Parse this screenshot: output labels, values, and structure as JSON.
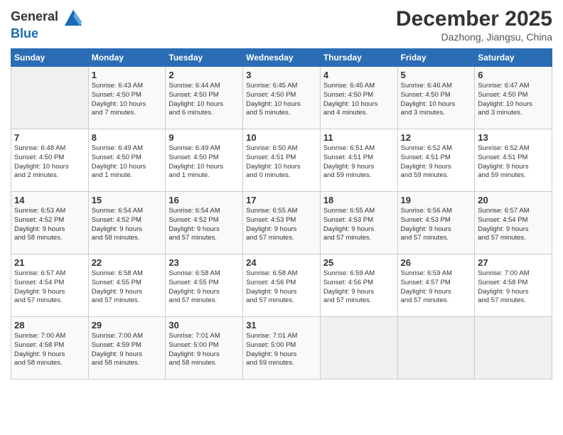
{
  "header": {
    "logo_line1": "General",
    "logo_line2": "Blue",
    "month": "December 2025",
    "location": "Dazhong, Jiangsu, China"
  },
  "weekdays": [
    "Sunday",
    "Monday",
    "Tuesday",
    "Wednesday",
    "Thursday",
    "Friday",
    "Saturday"
  ],
  "weeks": [
    [
      {
        "num": "",
        "info": ""
      },
      {
        "num": "1",
        "info": "Sunrise: 6:43 AM\nSunset: 4:50 PM\nDaylight: 10 hours\nand 7 minutes."
      },
      {
        "num": "2",
        "info": "Sunrise: 6:44 AM\nSunset: 4:50 PM\nDaylight: 10 hours\nand 6 minutes."
      },
      {
        "num": "3",
        "info": "Sunrise: 6:45 AM\nSunset: 4:50 PM\nDaylight: 10 hours\nand 5 minutes."
      },
      {
        "num": "4",
        "info": "Sunrise: 6:45 AM\nSunset: 4:50 PM\nDaylight: 10 hours\nand 4 minutes."
      },
      {
        "num": "5",
        "info": "Sunrise: 6:46 AM\nSunset: 4:50 PM\nDaylight: 10 hours\nand 3 minutes."
      },
      {
        "num": "6",
        "info": "Sunrise: 6:47 AM\nSunset: 4:50 PM\nDaylight: 10 hours\nand 3 minutes."
      }
    ],
    [
      {
        "num": "7",
        "info": "Sunrise: 6:48 AM\nSunset: 4:50 PM\nDaylight: 10 hours\nand 2 minutes."
      },
      {
        "num": "8",
        "info": "Sunrise: 6:49 AM\nSunset: 4:50 PM\nDaylight: 10 hours\nand 1 minute."
      },
      {
        "num": "9",
        "info": "Sunrise: 6:49 AM\nSunset: 4:50 PM\nDaylight: 10 hours\nand 1 minute."
      },
      {
        "num": "10",
        "info": "Sunrise: 6:50 AM\nSunset: 4:51 PM\nDaylight: 10 hours\nand 0 minutes."
      },
      {
        "num": "11",
        "info": "Sunrise: 6:51 AM\nSunset: 4:51 PM\nDaylight: 9 hours\nand 59 minutes."
      },
      {
        "num": "12",
        "info": "Sunrise: 6:52 AM\nSunset: 4:51 PM\nDaylight: 9 hours\nand 59 minutes."
      },
      {
        "num": "13",
        "info": "Sunrise: 6:52 AM\nSunset: 4:51 PM\nDaylight: 9 hours\nand 59 minutes."
      }
    ],
    [
      {
        "num": "14",
        "info": "Sunrise: 6:53 AM\nSunset: 4:52 PM\nDaylight: 9 hours\nand 58 minutes."
      },
      {
        "num": "15",
        "info": "Sunrise: 6:54 AM\nSunset: 4:52 PM\nDaylight: 9 hours\nand 58 minutes."
      },
      {
        "num": "16",
        "info": "Sunrise: 6:54 AM\nSunset: 4:52 PM\nDaylight: 9 hours\nand 57 minutes."
      },
      {
        "num": "17",
        "info": "Sunrise: 6:55 AM\nSunset: 4:53 PM\nDaylight: 9 hours\nand 57 minutes."
      },
      {
        "num": "18",
        "info": "Sunrise: 6:55 AM\nSunset: 4:53 PM\nDaylight: 9 hours\nand 57 minutes."
      },
      {
        "num": "19",
        "info": "Sunrise: 6:56 AM\nSunset: 4:53 PM\nDaylight: 9 hours\nand 57 minutes."
      },
      {
        "num": "20",
        "info": "Sunrise: 6:57 AM\nSunset: 4:54 PM\nDaylight: 9 hours\nand 57 minutes."
      }
    ],
    [
      {
        "num": "21",
        "info": "Sunrise: 6:57 AM\nSunset: 4:54 PM\nDaylight: 9 hours\nand 57 minutes."
      },
      {
        "num": "22",
        "info": "Sunrise: 6:58 AM\nSunset: 4:55 PM\nDaylight: 9 hours\nand 57 minutes."
      },
      {
        "num": "23",
        "info": "Sunrise: 6:58 AM\nSunset: 4:55 PM\nDaylight: 9 hours\nand 57 minutes."
      },
      {
        "num": "24",
        "info": "Sunrise: 6:58 AM\nSunset: 4:56 PM\nDaylight: 9 hours\nand 57 minutes."
      },
      {
        "num": "25",
        "info": "Sunrise: 6:59 AM\nSunset: 4:56 PM\nDaylight: 9 hours\nand 57 minutes."
      },
      {
        "num": "26",
        "info": "Sunrise: 6:59 AM\nSunset: 4:57 PM\nDaylight: 9 hours\nand 57 minutes."
      },
      {
        "num": "27",
        "info": "Sunrise: 7:00 AM\nSunset: 4:58 PM\nDaylight: 9 hours\nand 57 minutes."
      }
    ],
    [
      {
        "num": "28",
        "info": "Sunrise: 7:00 AM\nSunset: 4:58 PM\nDaylight: 9 hours\nand 58 minutes."
      },
      {
        "num": "29",
        "info": "Sunrise: 7:00 AM\nSunset: 4:59 PM\nDaylight: 9 hours\nand 58 minutes."
      },
      {
        "num": "30",
        "info": "Sunrise: 7:01 AM\nSunset: 5:00 PM\nDaylight: 9 hours\nand 58 minutes."
      },
      {
        "num": "31",
        "info": "Sunrise: 7:01 AM\nSunset: 5:00 PM\nDaylight: 9 hours\nand 59 minutes."
      },
      {
        "num": "",
        "info": ""
      },
      {
        "num": "",
        "info": ""
      },
      {
        "num": "",
        "info": ""
      }
    ]
  ]
}
